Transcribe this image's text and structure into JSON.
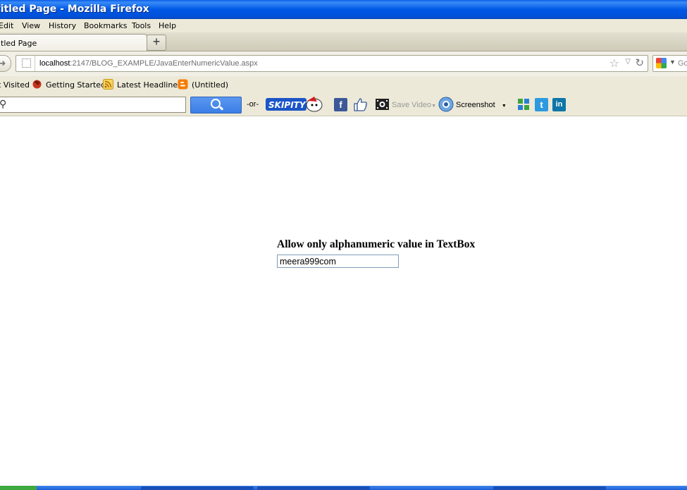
{
  "window": {
    "title": "titled Page - Mozilla Firefox"
  },
  "menu": {
    "items": [
      "Edit",
      "View",
      "History",
      "Bookmarks",
      "Tools",
      "Help"
    ]
  },
  "tab": {
    "title": "tled Page",
    "new_tab": "+"
  },
  "nav": {
    "url_host": "localhost",
    "url_path": ":2147/BLOG_EXAMPLE/JavaEnterNumericValue.aspx",
    "search_engine_text": "Go"
  },
  "bookmarks": [
    "t Visited",
    "Getting Started",
    "Latest Headlines",
    "(Untitled)"
  ],
  "toolbar": {
    "or_text": "-or-",
    "skipity_label": "SKIPITY",
    "save_video": "Save Video",
    "screenshot": "Screenshot"
  },
  "page": {
    "heading": "Allow only alphanumeric value in TextBox",
    "textbox_value": "meera999com"
  },
  "colors": {
    "titlebar": "#0058e6",
    "chrome": "#ece9d8",
    "search_button": "#4a8aec",
    "facebook": "#3b5998",
    "twitter": "#2d9ae0",
    "linkedin": "#0e76a8"
  }
}
